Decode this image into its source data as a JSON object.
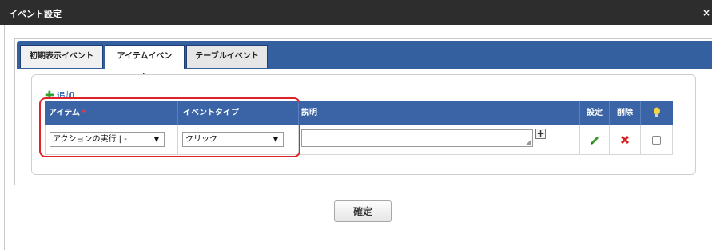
{
  "dialog": {
    "title": "イベント設定",
    "close_glyph": "×"
  },
  "tabs": [
    {
      "label": "初期表示イベント"
    },
    {
      "label": "アイテムイベント"
    },
    {
      "label": "テーブルイベント"
    }
  ],
  "active_tab_index": 1,
  "add_link": {
    "label": "追加",
    "icon": "plus-icon",
    "icon_color": "#2ea12e"
  },
  "table": {
    "headers": {
      "item": "アイテム",
      "required_mark": "*",
      "event_type": "イベントタイプ",
      "description": "説明",
      "settings": "設定",
      "delete": "削除",
      "hint_icon": "lightbulb-icon"
    },
    "rows": [
      {
        "item_value": "アクションの実行 | -",
        "event_type_value": "クリック",
        "description_value": "",
        "settings_icon": "pencil-icon",
        "delete_icon": "delete-x-icon",
        "checked": false
      }
    ]
  },
  "confirm_button": {
    "label": "確定"
  },
  "colors": {
    "titlebar": "#2d2d2d",
    "tabbar": "#3460a0",
    "header": "#3a64a6",
    "highlight": "#e0222a",
    "delete": "#d42020",
    "edit": "#3a9a2a"
  }
}
